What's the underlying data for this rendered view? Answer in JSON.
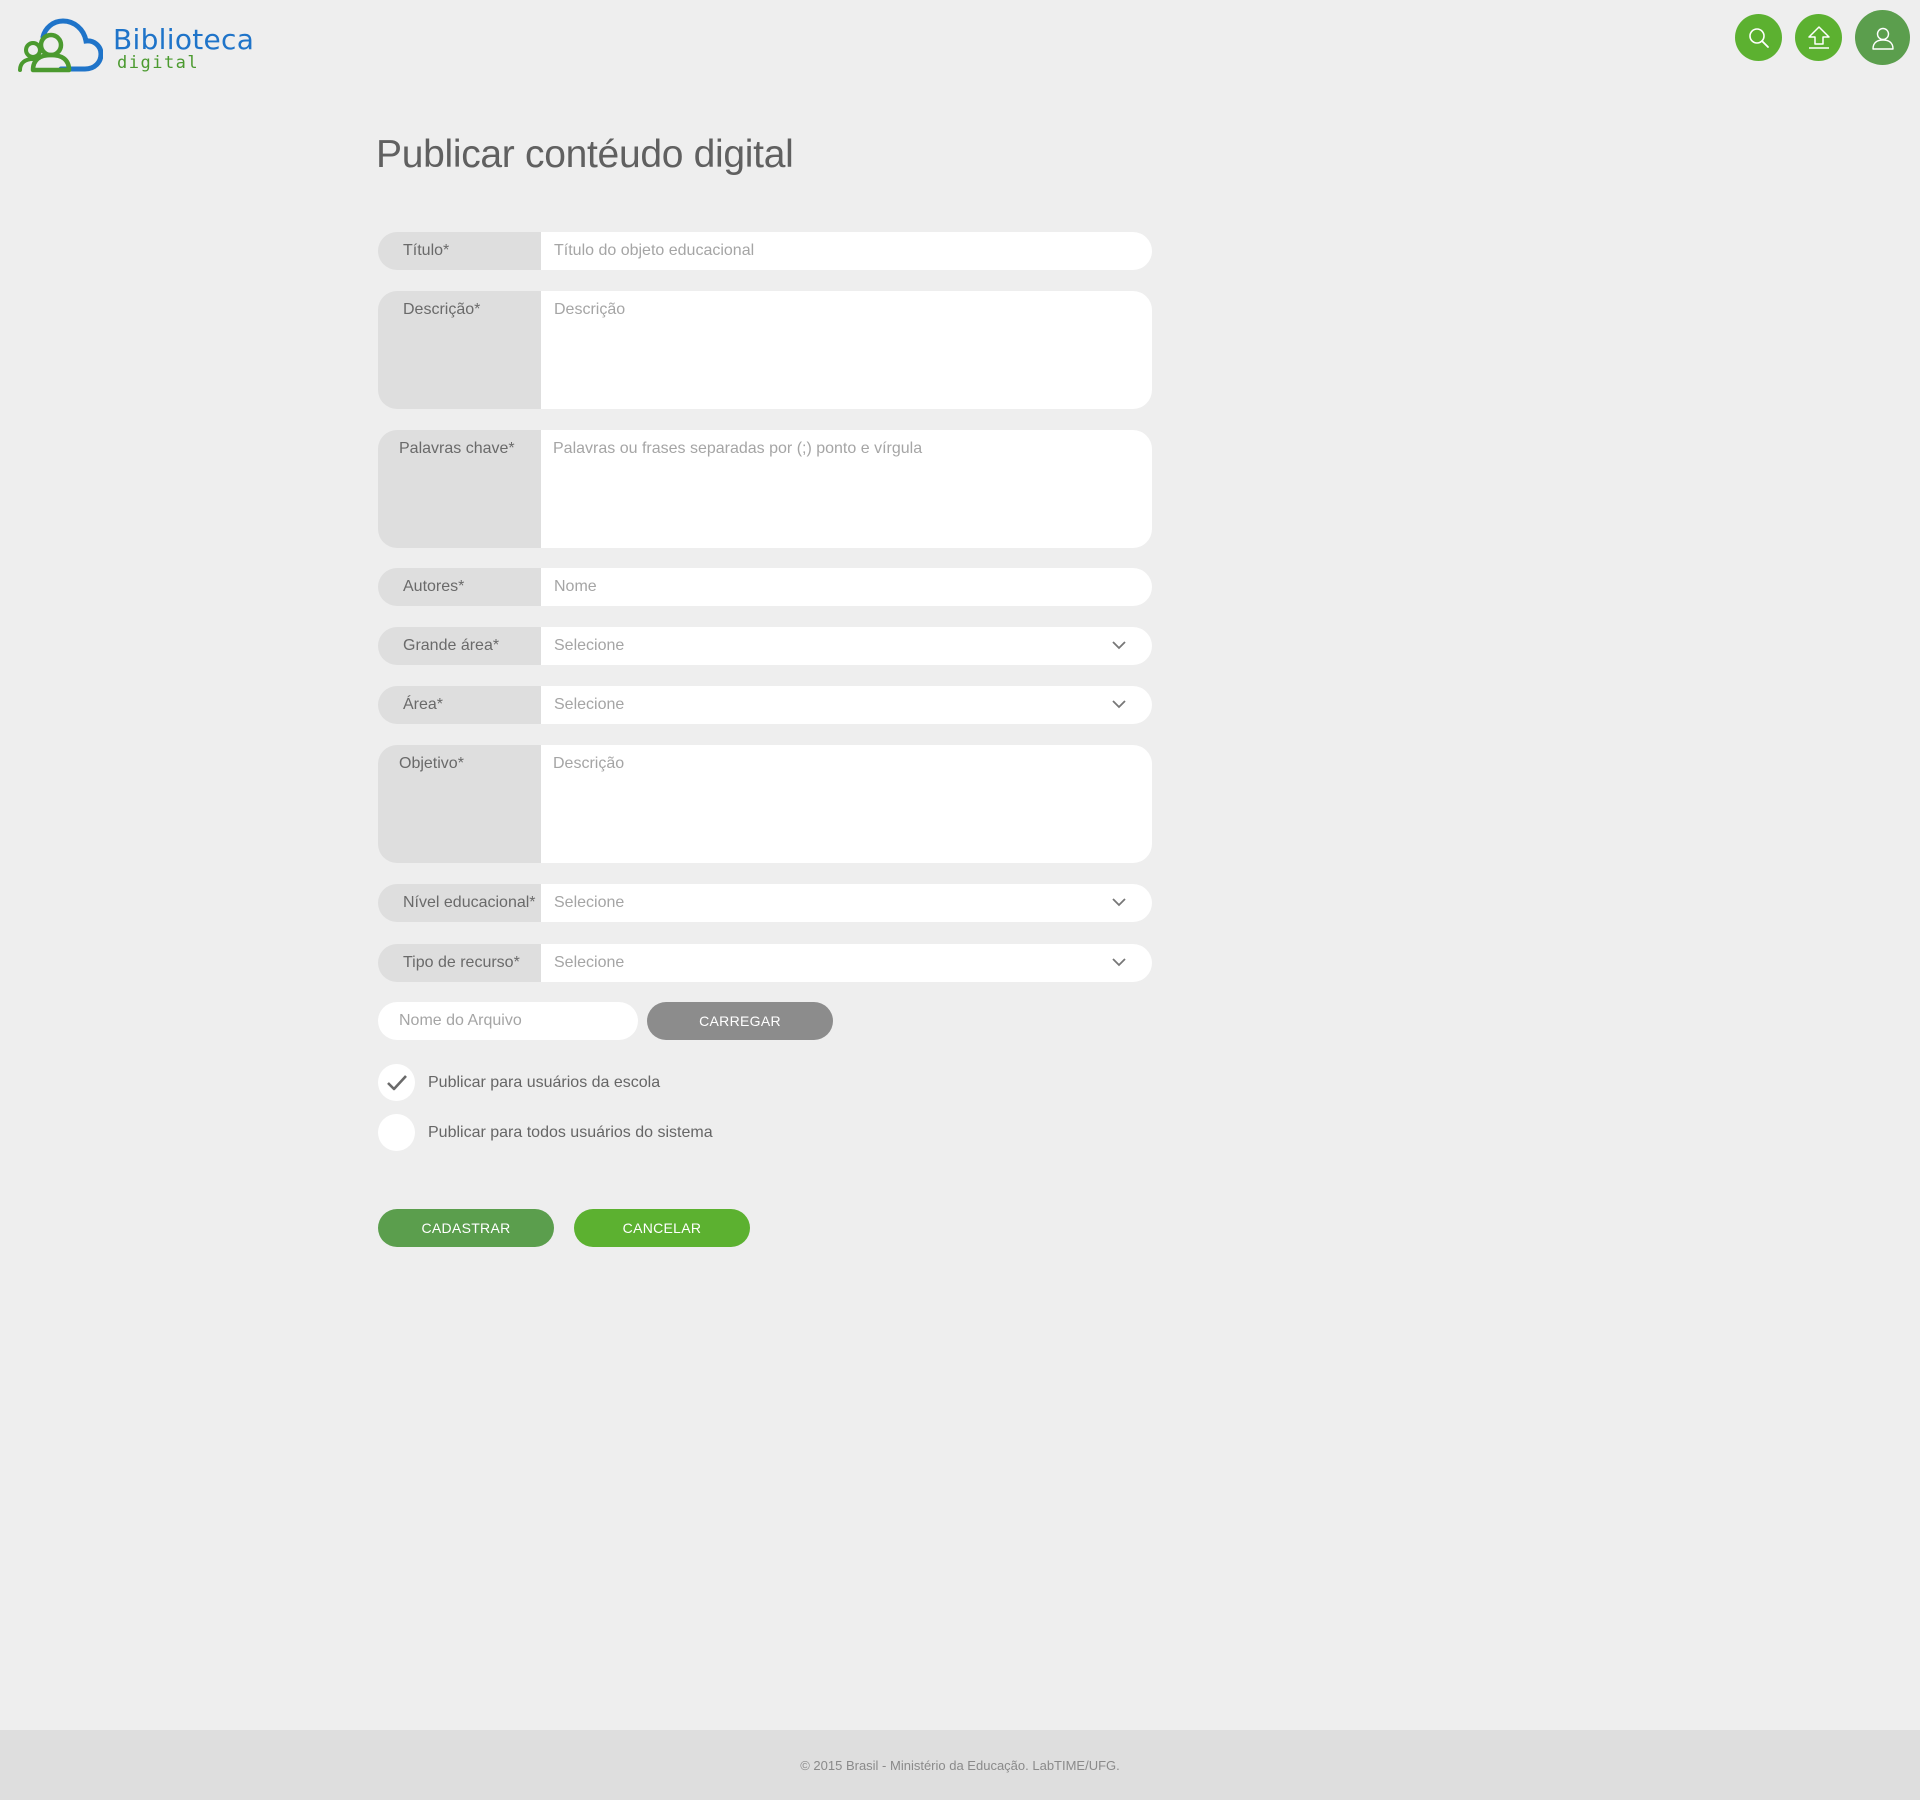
{
  "brand": {
    "name": "Biblioteca",
    "subtitle": "digital",
    "blue": "#1f74c9",
    "green": "#4b9a2f"
  },
  "header": {
    "icons": [
      "search-icon",
      "upload-icon",
      "user-icon"
    ],
    "accent": "#5cb130",
    "user_accent": "#5b9e4d"
  },
  "page": {
    "title": "Publicar contéudo digital"
  },
  "form": {
    "titulo": {
      "label": "Título*",
      "placeholder": "Título do objeto educacional"
    },
    "descricao": {
      "label": "Descrição*",
      "placeholder": "Descrição"
    },
    "palavras": {
      "label": "Palavras chave*",
      "placeholder": "Palavras ou frases separadas por (;) ponto e vírgula"
    },
    "autores": {
      "label": "Autores*",
      "placeholder": "Nome"
    },
    "grande_area": {
      "label": "Grande área*",
      "value": "Selecione"
    },
    "area": {
      "label": "Área*",
      "value": "Selecione"
    },
    "objetivo": {
      "label": "Objetivo*",
      "placeholder": "Descrição"
    },
    "nivel": {
      "label": "Nível educacional*",
      "value": "Selecione"
    },
    "tipo": {
      "label": "Tipo de recurso*",
      "value": "Selecione"
    },
    "arquivo": {
      "placeholder": "Nome do Arquivo",
      "button": "CARREGAR"
    },
    "options": [
      {
        "label": "Publicar para usuários da escola",
        "checked": true
      },
      {
        "label": "Publicar para todos usuários do sistema",
        "checked": false
      }
    ],
    "submit": "CADASTRAR",
    "cancel": "CANCELAR"
  },
  "footer": {
    "text": "© 2015 Brasil - Ministério da Educação. LabTIME/UFG."
  }
}
